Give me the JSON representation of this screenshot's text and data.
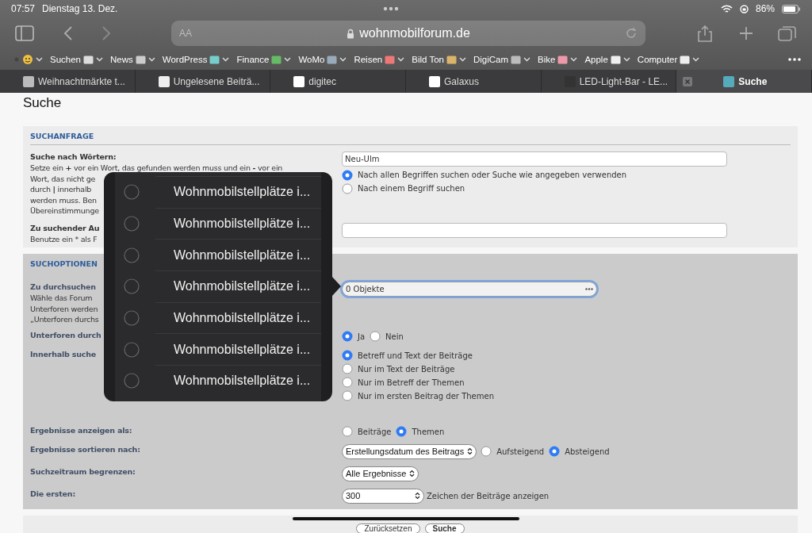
{
  "status_bar": {
    "time": "07:57",
    "date": "Dienstag 13. Dez.",
    "battery": "86%"
  },
  "toolbar": {
    "reader": "AA",
    "address": "wohnmobilforum.de"
  },
  "bookmarks": [
    {
      "kind": "icon"
    },
    {
      "kind": "text",
      "label": "Suchen"
    },
    {
      "kind": "text",
      "label": "News"
    },
    {
      "kind": "text",
      "label": "WordPress"
    },
    {
      "kind": "text",
      "label": "Finance"
    },
    {
      "kind": "text",
      "label": "WoMo"
    },
    {
      "kind": "text",
      "label": "Reisen"
    },
    {
      "kind": "text",
      "label": "Bild Ton"
    },
    {
      "kind": "text",
      "label": "DigiCam"
    },
    {
      "kind": "text",
      "label": "Bike"
    },
    {
      "kind": "text",
      "label": "Apple"
    },
    {
      "kind": "text",
      "label": "Computer"
    }
  ],
  "tabs": [
    {
      "label": "Weihnachtmärkte t...",
      "selected": false
    },
    {
      "label": "Ungelesene Beiträ...",
      "selected": false
    },
    {
      "label": "digitec",
      "selected": false
    },
    {
      "label": "Galaxus",
      "selected": false
    },
    {
      "label": "LED-Light-Bar - LE...",
      "selected": false
    },
    {
      "label": "Suche",
      "selected": true
    }
  ],
  "page": {
    "title": "Suche",
    "sections": [
      {
        "heading": "SUCHANFRAGE",
        "rows": [
          {
            "label": "Suche nach Wörtern:",
            "description": [
              "Setze ein **+** vor ein Wort, das gefunden werden muss und ein **-** vor ein",
              "Wort, das nicht ge",
              "durch **|** innerhalb",
              "werden muss. Ben",
              "Übereinstimmunge"
            ],
            "controls": [
              {
                "kind": "text",
                "value": "Neu-Ulm"
              },
              {
                "kind": "radio-list",
                "options": [
                  {
                    "label": "Nach allen Begriffen suchen oder Suche wie angegeben verwenden",
                    "selected": true
                  },
                  {
                    "label": "Nach einem Begriff suchen",
                    "selected": false
                  }
                ]
              }
            ]
          },
          {
            "label": "Zu suchender Au",
            "description": [
              "Benutze ein * als F"
            ],
            "controls": [
              {
                "kind": "text"
              }
            ]
          }
        ]
      },
      {
        "heading": "SUCHOPTIONEN",
        "rows": [
          {
            "label": "Zu durchsuchen",
            "description": [
              "Wähle das Forum",
              "Unterforen werden",
              "„Unterforen durchs"
            ],
            "controls": [
              {
                "kind": "multiselect",
                "value": "0 Objekte",
                "focused": true
              }
            ]
          },
          {
            "label": "Unterforen durch",
            "controls": [
              {
                "kind": "radio-row",
                "options": [
                  {
                    "label": "Ja",
                    "selected": true
                  },
                  {
                    "label": "Nein",
                    "selected": false
                  }
                ]
              }
            ]
          },
          {
            "label": "Innerhalb suche",
            "controls": [
              {
                "kind": "radio-list",
                "options": [
                  {
                    "label": "Betreff und Text der Beiträge",
                    "selected": true
                  },
                  {
                    "label": "Nur im Text der Beiträge",
                    "selected": false
                  },
                  {
                    "label": "Nur im Betreff der Themen",
                    "selected": false
                  },
                  {
                    "label": "Nur im ersten Beitrag der Themen",
                    "selected": false
                  }
                ]
              }
            ]
          },
          {
            "label": "Ergebnisse anzeigen als:",
            "controls": [
              {
                "kind": "radio-row",
                "options": [
                  {
                    "label": "Beiträge",
                    "selected": false
                  },
                  {
                    "label": "Themen",
                    "selected": true
                  }
                ]
              }
            ]
          },
          {
            "label": "Ergebnisse sortieren nach:",
            "controls": [
              {
                "kind": "select",
                "value": "Erstellungsdatum des Beitrags"
              },
              {
                "kind": "radio-row",
                "options": [
                  {
                    "label": "Aufsteigend",
                    "selected": false
                  },
                  {
                    "label": "Absteigend",
                    "selected": true
                  }
                ]
              }
            ]
          },
          {
            "label": "Suchzeitraum begrenzen:",
            "controls": [
              {
                "kind": "select",
                "value": "Alle Ergebnisse"
              }
            ]
          },
          {
            "label": "Die ersten:",
            "controls": [
              {
                "kind": "wide-select",
                "value": "300"
              },
              {
                "kind": "note",
                "text": "Zeichen der Beiträge anzeigen"
              }
            ]
          }
        ]
      }
    ],
    "buttons": [
      "Zurücksetzen",
      "Suche"
    ]
  },
  "picker": {
    "items": [
      {
        "label": "Wohnmobilstellplätze i...",
        "selected": false
      },
      {
        "label": "Wohnmobilstellplätze i...",
        "selected": false
      },
      {
        "label": "Wohnmobilstellplätze i...",
        "selected": false
      },
      {
        "label": "Wohnmobilstellplätze i...",
        "selected": false
      },
      {
        "label": "Wohnmobilstellplätze i...",
        "selected": false
      },
      {
        "label": "Wohnmobilstellplätze i...",
        "selected": false
      },
      {
        "label": "Wohnmobilstellplätze i...",
        "selected": false
      }
    ]
  }
}
